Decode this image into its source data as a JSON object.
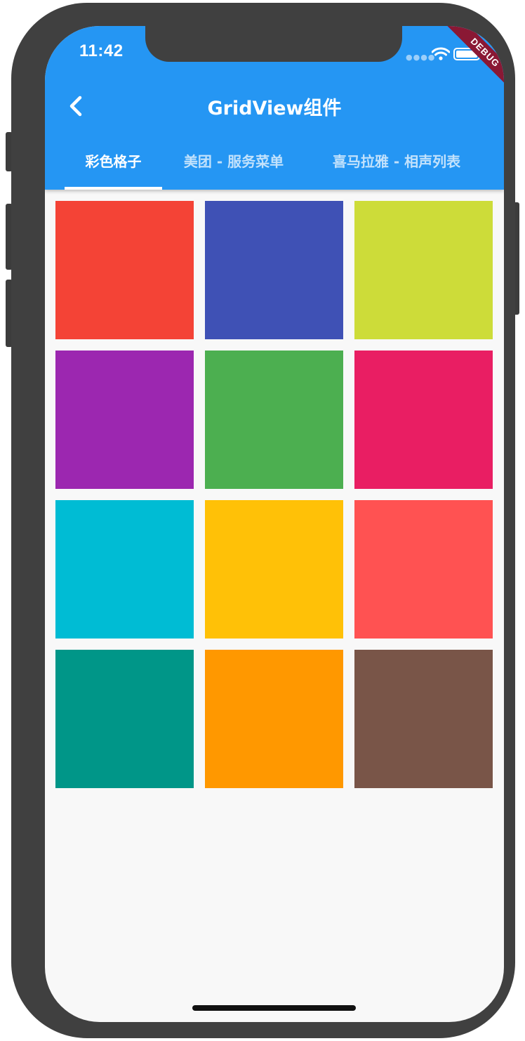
{
  "status_bar": {
    "time": "11:42",
    "wifi_icon": "wifi-icon",
    "battery_icon": "battery-icon"
  },
  "debug_banner": {
    "label": "DEBUG"
  },
  "app_bar": {
    "title": "GridView组件",
    "back_icon": "chevron-left-icon",
    "background": "#2596f3"
  },
  "tabs": [
    {
      "label": "彩色格子",
      "active": true
    },
    {
      "label": "美团 - 服务菜单",
      "active": false
    },
    {
      "label": "喜马拉雅 - 相声列表",
      "active": false
    }
  ],
  "grid": {
    "columns": 3,
    "cells": [
      {
        "color": "#f44336"
      },
      {
        "color": "#3f51b5"
      },
      {
        "color": "#cddc39"
      },
      {
        "color": "#9c27b0"
      },
      {
        "color": "#4caf50"
      },
      {
        "color": "#e91e63"
      },
      {
        "color": "#00bcd4"
      },
      {
        "color": "#ffc107"
      },
      {
        "color": "#ff5252"
      },
      {
        "color": "#009688"
      },
      {
        "color": "#ff9800"
      },
      {
        "color": "#795548"
      }
    ]
  }
}
